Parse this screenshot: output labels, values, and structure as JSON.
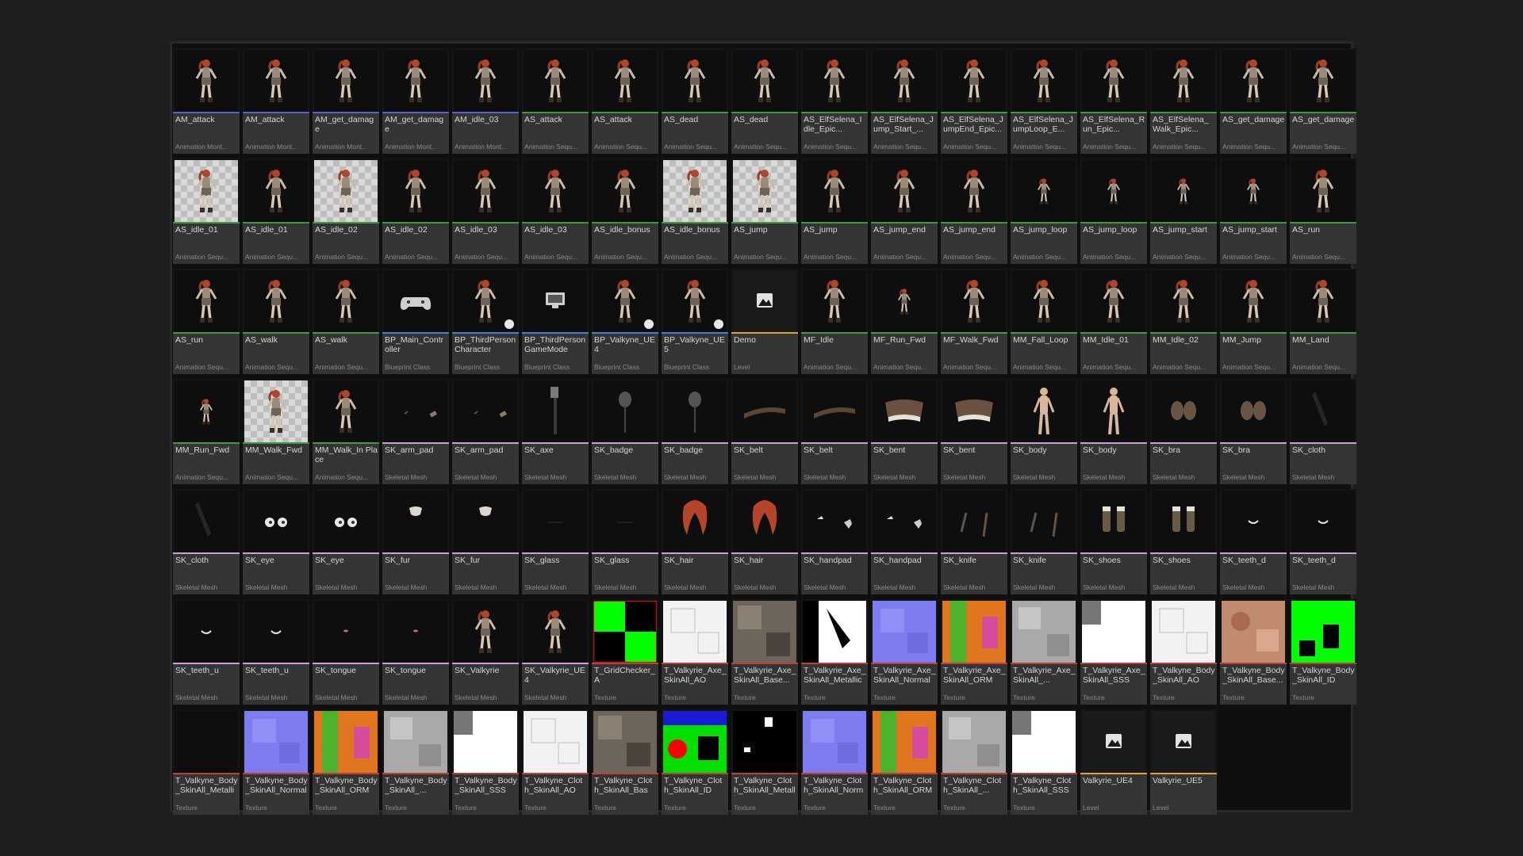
{
  "type_colors": {
    "Animation Montage": "#5b5fd6",
    "Animation Sequence": "#3f9a3f",
    "Blueprint Class": "#3d7fd9",
    "Level": "#e3a13a",
    "Skeletal Mesh": "#c9a0dc",
    "Texture": "#c33b3b"
  },
  "assets": [
    {
      "name": "AM_attack",
      "type": "Animation Mont...",
      "kind": "Animation Montage",
      "thumb": "char"
    },
    {
      "name": "AM_attack",
      "type": "Animation Mont...",
      "kind": "Animation Montage",
      "thumb": "char"
    },
    {
      "name": "AM_get_damage",
      "type": "Animation Mont...",
      "kind": "Animation Montage",
      "thumb": "char"
    },
    {
      "name": "AM_get_damage",
      "type": "Animation Mont...",
      "kind": "Animation Montage",
      "thumb": "char"
    },
    {
      "name": "AM_idle_03",
      "type": "Animation Mont...",
      "kind": "Animation Montage",
      "thumb": "char"
    },
    {
      "name": "AS_attack",
      "type": "Animation Sequ...",
      "kind": "Animation Sequence",
      "thumb": "char"
    },
    {
      "name": "AS_attack",
      "type": "Animation Sequ...",
      "kind": "Animation Sequence",
      "thumb": "char"
    },
    {
      "name": "AS_dead",
      "type": "Animation Sequ...",
      "kind": "Animation Sequence",
      "thumb": "char"
    },
    {
      "name": "AS_dead",
      "type": "Animation Sequ...",
      "kind": "Animation Sequence",
      "thumb": "char"
    },
    {
      "name": "AS_ElfSelena_Idle_Epic...",
      "type": "Animation Sequ...",
      "kind": "Animation Sequence",
      "thumb": "char"
    },
    {
      "name": "AS_ElfSelena_Jump_Start_...",
      "type": "Animation Sequ...",
      "kind": "Animation Sequence",
      "thumb": "char"
    },
    {
      "name": "AS_ElfSelena_JumpEnd_Epic...",
      "type": "Animation Sequ...",
      "kind": "Animation Sequence",
      "thumb": "char"
    },
    {
      "name": "AS_ElfSelena_JumpLoop_E...",
      "type": "Animation Sequ...",
      "kind": "Animation Sequence",
      "thumb": "char"
    },
    {
      "name": "AS_ElfSelena_Run_Epic...",
      "type": "Animation Sequ...",
      "kind": "Animation Sequence",
      "thumb": "char"
    },
    {
      "name": "AS_ElfSelena_Walk_Epic...",
      "type": "Animation Sequ...",
      "kind": "Animation Sequence",
      "thumb": "char"
    },
    {
      "name": "AS_get_damage",
      "type": "Animation Sequ...",
      "kind": "Animation Sequence",
      "thumb": "char"
    },
    {
      "name": "AS_get_damage",
      "type": "Animation Sequ...",
      "kind": "Animation Sequence",
      "thumb": "char"
    },
    {
      "name": "AS_idle_01",
      "type": "Animation Sequ...",
      "kind": "Animation Sequence",
      "thumb": "char-floor"
    },
    {
      "name": "AS_idle_01",
      "type": "Animation Sequ...",
      "kind": "Animation Sequence",
      "thumb": "char"
    },
    {
      "name": "AS_idle_02",
      "type": "Animation Sequ...",
      "kind": "Animation Sequence",
      "thumb": "char-floor"
    },
    {
      "name": "AS_idle_02",
      "type": "Animation Sequ...",
      "kind": "Animation Sequence",
      "thumb": "char"
    },
    {
      "name": "AS_idle_03",
      "type": "Animation Sequ...",
      "kind": "Animation Sequence",
      "thumb": "char"
    },
    {
      "name": "AS_idle_03",
      "type": "Animation Sequ...",
      "kind": "Animation Sequence",
      "thumb": "char"
    },
    {
      "name": "AS_idle_bonus",
      "type": "Animation Sequ...",
      "kind": "Animation Sequence",
      "thumb": "char"
    },
    {
      "name": "AS_idle_bonus",
      "type": "Animation Sequ...",
      "kind": "Animation Sequence",
      "thumb": "char-floor"
    },
    {
      "name": "AS_jump",
      "type": "Animation Sequ...",
      "kind": "Animation Sequence",
      "thumb": "char-floor"
    },
    {
      "name": "AS_jump",
      "type": "Animation Sequ...",
      "kind": "Animation Sequence",
      "thumb": "char"
    },
    {
      "name": "AS_jump_end",
      "type": "Animation Sequ...",
      "kind": "Animation Sequence",
      "thumb": "char"
    },
    {
      "name": "AS_jump_end",
      "type": "Animation Sequ...",
      "kind": "Animation Sequence",
      "thumb": "char"
    },
    {
      "name": "AS_jump_loop",
      "type": "Animation Sequ...",
      "kind": "Animation Sequence",
      "thumb": "char-small"
    },
    {
      "name": "AS_jump_loop",
      "type": "Animation Sequ...",
      "kind": "Animation Sequence",
      "thumb": "char-small"
    },
    {
      "name": "AS_jump_start",
      "type": "Animation Sequ...",
      "kind": "Animation Sequence",
      "thumb": "char-small"
    },
    {
      "name": "AS_jump_start",
      "type": "Animation Sequ...",
      "kind": "Animation Sequence",
      "thumb": "char-small"
    },
    {
      "name": "AS_run",
      "type": "Animation Sequ...",
      "kind": "Animation Sequence",
      "thumb": "char"
    },
    {
      "name": "AS_run",
      "type": "Animation Sequ...",
      "kind": "Animation Sequence",
      "thumb": "char"
    },
    {
      "name": "AS_walk",
      "type": "Animation Sequ...",
      "kind": "Animation Sequence",
      "thumb": "char"
    },
    {
      "name": "AS_walk",
      "type": "Animation Sequ...",
      "kind": "Animation Sequence",
      "thumb": "char"
    },
    {
      "name": "BP_Main_Controller",
      "type": "Blueprint Class",
      "kind": "Blueprint Class",
      "thumb": "gamepad"
    },
    {
      "name": "BP_ThirdPerson Character",
      "type": "Blueprint Class",
      "kind": "Blueprint Class",
      "thumb": "char",
      "badge": true
    },
    {
      "name": "BP_ThirdPerson GameMode",
      "type": "Blueprint Class",
      "kind": "Blueprint Class",
      "thumb": "monitor"
    },
    {
      "name": "BP_Valkyne_UE4",
      "type": "Blueprint Class",
      "kind": "Blueprint Class",
      "thumb": "char",
      "badge": true
    },
    {
      "name": "BP_Valkyne_UE5",
      "type": "Blueprint Class",
      "kind": "Blueprint Class",
      "thumb": "char",
      "badge": true
    },
    {
      "name": "Demo",
      "type": "Level",
      "kind": "Level",
      "thumb": "level"
    },
    {
      "name": "MF_Idle",
      "type": "Animation Sequ...",
      "kind": "Animation Sequence",
      "thumb": "char"
    },
    {
      "name": "MF_Run_Fwd",
      "type": "Animation Sequ...",
      "kind": "Animation Sequence",
      "thumb": "char-small"
    },
    {
      "name": "MF_Walk_Fwd",
      "type": "Animation Sequ...",
      "kind": "Animation Sequence",
      "thumb": "char"
    },
    {
      "name": "MM_Fall_Loop",
      "type": "Animation Sequ...",
      "kind": "Animation Sequence",
      "thumb": "char"
    },
    {
      "name": "MM_Idle_01",
      "type": "Animation Sequ...",
      "kind": "Animation Sequence",
      "thumb": "char"
    },
    {
      "name": "MM_Idle_02",
      "type": "Animation Sequ...",
      "kind": "Animation Sequence",
      "thumb": "char"
    },
    {
      "name": "MM_Jump",
      "type": "Animation Sequ...",
      "kind": "Animation Sequence",
      "thumb": "char"
    },
    {
      "name": "MM_Land",
      "type": "Animation Sequ...",
      "kind": "Animation Sequence",
      "thumb": "char"
    },
    {
      "name": "MM_Run_Fwd",
      "type": "Animation Sequ...",
      "kind": "Animation Sequence",
      "thumb": "char-small"
    },
    {
      "name": "MM_Walk_Fwd",
      "type": "Animation Sequ...",
      "kind": "Animation Sequence",
      "thumb": "char-floor"
    },
    {
      "name": "MM_Walk_In Place",
      "type": "Animation Sequ...",
      "kind": "Animation Sequence",
      "thumb": "char"
    },
    {
      "name": "SK_arm_pad",
      "type": "Skeletal Mesh",
      "kind": "Skeletal Mesh",
      "thumb": "mesh-armpad"
    },
    {
      "name": "SK_arm_pad",
      "type": "Skeletal Mesh",
      "kind": "Skeletal Mesh",
      "thumb": "mesh-armpad"
    },
    {
      "name": "SK_axe",
      "type": "Skeletal Mesh",
      "kind": "Skeletal Mesh",
      "thumb": "mesh-axe"
    },
    {
      "name": "SK_badge",
      "type": "Skeletal Mesh",
      "kind": "Skeletal Mesh",
      "thumb": "mesh-badge"
    },
    {
      "name": "SK_badge",
      "type": "Skeletal Mesh",
      "kind": "Skeletal Mesh",
      "thumb": "mesh-badge"
    },
    {
      "name": "SK_belt",
      "type": "Skeletal Mesh",
      "kind": "Skeletal Mesh",
      "thumb": "mesh-belt"
    },
    {
      "name": "SK_belt",
      "type": "Skeletal Mesh",
      "kind": "Skeletal Mesh",
      "thumb": "mesh-belt"
    },
    {
      "name": "SK_bent",
      "type": "Skeletal Mesh",
      "kind": "Skeletal Mesh",
      "thumb": "mesh-bent"
    },
    {
      "name": "SK_bent",
      "type": "Skeletal Mesh",
      "kind": "Skeletal Mesh",
      "thumb": "mesh-bent"
    },
    {
      "name": "SK_body",
      "type": "Skeletal Mesh",
      "kind": "Skeletal Mesh",
      "thumb": "mesh-body"
    },
    {
      "name": "SK_body",
      "type": "Skeletal Mesh",
      "kind": "Skeletal Mesh",
      "thumb": "mesh-body"
    },
    {
      "name": "SK_bra",
      "type": "Skeletal Mesh",
      "kind": "Skeletal Mesh",
      "thumb": "mesh-bra"
    },
    {
      "name": "SK_bra",
      "type": "Skeletal Mesh",
      "kind": "Skeletal Mesh",
      "thumb": "mesh-bra"
    },
    {
      "name": "SK_cloth",
      "type": "Skeletal Mesh",
      "kind": "Skeletal Mesh",
      "thumb": "mesh-cloth"
    },
    {
      "name": "SK_cloth",
      "type": "Skeletal Mesh",
      "kind": "Skeletal Mesh",
      "thumb": "mesh-cloth"
    },
    {
      "name": "SK_eye",
      "type": "Skeletal Mesh",
      "kind": "Skeletal Mesh",
      "thumb": "mesh-eye"
    },
    {
      "name": "SK_eye",
      "type": "Skeletal Mesh",
      "kind": "Skeletal Mesh",
      "thumb": "mesh-eye"
    },
    {
      "name": "SK_fur",
      "type": "Skeletal Mesh",
      "kind": "Skeletal Mesh",
      "thumb": "mesh-fur"
    },
    {
      "name": "SK_fur",
      "type": "Skeletal Mesh",
      "kind": "Skeletal Mesh",
      "thumb": "mesh-fur"
    },
    {
      "name": "SK_glass",
      "type": "Skeletal Mesh",
      "kind": "Skeletal Mesh",
      "thumb": "mesh-glass"
    },
    {
      "name": "SK_glass",
      "type": "Skeletal Mesh",
      "kind": "Skeletal Mesh",
      "thumb": "mesh-glass"
    },
    {
      "name": "SK_hair",
      "type": "Skeletal Mesh",
      "kind": "Skeletal Mesh",
      "thumb": "mesh-hair"
    },
    {
      "name": "SK_hair",
      "type": "Skeletal Mesh",
      "kind": "Skeletal Mesh",
      "thumb": "mesh-hair"
    },
    {
      "name": "SK_handpad",
      "type": "Skeletal Mesh",
      "kind": "Skeletal Mesh",
      "thumb": "mesh-handpad"
    },
    {
      "name": "SK_handpad",
      "type": "Skeletal Mesh",
      "kind": "Skeletal Mesh",
      "thumb": "mesh-handpad"
    },
    {
      "name": "SK_knife",
      "type": "Skeletal Mesh",
      "kind": "Skeletal Mesh",
      "thumb": "mesh-knife"
    },
    {
      "name": "SK_knife",
      "type": "Skeletal Mesh",
      "kind": "Skeletal Mesh",
      "thumb": "mesh-knife"
    },
    {
      "name": "SK_shoes",
      "type": "Skeletal Mesh",
      "kind": "Skeletal Mesh",
      "thumb": "mesh-shoes"
    },
    {
      "name": "SK_shoes",
      "type": "Skeletal Mesh",
      "kind": "Skeletal Mesh",
      "thumb": "mesh-shoes"
    },
    {
      "name": "SK_teeth_d",
      "type": "Skeletal Mesh",
      "kind": "Skeletal Mesh",
      "thumb": "mesh-teeth"
    },
    {
      "name": "SK_teeth_d",
      "type": "Skeletal Mesh",
      "kind": "Skeletal Mesh",
      "thumb": "mesh-teeth"
    },
    {
      "name": "SK_teeth_u",
      "type": "Skeletal Mesh",
      "kind": "Skeletal Mesh",
      "thumb": "mesh-teeth"
    },
    {
      "name": "SK_teeth_u",
      "type": "Skeletal Mesh",
      "kind": "Skeletal Mesh",
      "thumb": "mesh-teeth"
    },
    {
      "name": "SK_tongue",
      "type": "Skeletal Mesh",
      "kind": "Skeletal Mesh",
      "thumb": "mesh-tongue"
    },
    {
      "name": "SK_tongue",
      "type": "Skeletal Mesh",
      "kind": "Skeletal Mesh",
      "thumb": "mesh-tongue"
    },
    {
      "name": "SK_Valkyrie",
      "type": "Skeletal Mesh",
      "kind": "Skeletal Mesh",
      "thumb": "char"
    },
    {
      "name": "SK_Valkyrie_UE4",
      "type": "Skeletal Mesh",
      "kind": "Skeletal Mesh",
      "thumb": "char"
    },
    {
      "name": "T_GridChecker_A",
      "type": "Texture",
      "kind": "Texture",
      "thumb": "tex-checker"
    },
    {
      "name": "T_Valkyrie_Axe_SkinAll_AO",
      "type": "Texture",
      "kind": "Texture",
      "thumb": "tex-ao"
    },
    {
      "name": "T_Valkyrie_Axe_SkinAll_Base...",
      "type": "Texture",
      "kind": "Texture",
      "thumb": "tex-base"
    },
    {
      "name": "T_Valkyrie_Axe_SkinAll_Metallic",
      "type": "Texture",
      "kind": "Texture",
      "thumb": "tex-metal"
    },
    {
      "name": "T_Valkyrie_Axe_SkinAll_Normal",
      "type": "Texture",
      "kind": "Texture",
      "thumb": "tex-normal"
    },
    {
      "name": "T_Valkyrie_Axe_SkinAll_ORM",
      "type": "Texture",
      "kind": "Texture",
      "thumb": "tex-orm"
    },
    {
      "name": "T_Valkyrie_Axe_SkinAll_...",
      "type": "Texture",
      "kind": "Texture",
      "thumb": "tex-gray"
    },
    {
      "name": "T_Valkyrie_Axe_SkinAll_SSS",
      "type": "Texture",
      "kind": "Texture",
      "thumb": "tex-sss"
    },
    {
      "name": "T_Valkyne_Body_SkinAll_AO",
      "type": "Texture",
      "kind": "Texture",
      "thumb": "tex-ao"
    },
    {
      "name": "T_Valkyne_Body_SkinAll_Base...",
      "type": "Texture",
      "kind": "Texture",
      "thumb": "tex-skin"
    },
    {
      "name": "T_Valkyne_Body_SkinAll_ID",
      "type": "Texture",
      "kind": "Texture",
      "thumb": "tex-id"
    },
    {
      "name": "T_Valkyne_Body_SkinAll_Metallic",
      "type": "Texture",
      "kind": "Texture",
      "thumb": "tex-black"
    },
    {
      "name": "T_Valkyne_Body_SkinAll_Normal",
      "type": "Texture",
      "kind": "Texture",
      "thumb": "tex-normal"
    },
    {
      "name": "T_Valkyne_Body_SkinAll_ORM",
      "type": "Texture",
      "kind": "Texture",
      "thumb": "tex-orm"
    },
    {
      "name": "T_Valkyne_Body_SkinAll_...",
      "type": "Texture",
      "kind": "Texture",
      "thumb": "tex-gray"
    },
    {
      "name": "T_Valkyne_Body_SkinAll_SSS",
      "type": "Texture",
      "kind": "Texture",
      "thumb": "tex-sss"
    },
    {
      "name": "T_Valkyne_Cloth_SkinAll_AO",
      "type": "Texture",
      "kind": "Texture",
      "thumb": "tex-ao"
    },
    {
      "name": "T_Valkyne_Cloth_SkinAll_Base...",
      "type": "Texture",
      "kind": "Texture",
      "thumb": "tex-base"
    },
    {
      "name": "T_Valkyne_Cloth_SkinAll_ID",
      "type": "Texture",
      "kind": "Texture",
      "thumb": "tex-clothid"
    },
    {
      "name": "T_Valkyne_Cloth_SkinAll_Metallic",
      "type": "Texture",
      "kind": "Texture",
      "thumb": "tex-metal-dark"
    },
    {
      "name": "T_Valkyne_Cloth_SkinAll_Normal",
      "type": "Texture",
      "kind": "Texture",
      "thumb": "tex-normal"
    },
    {
      "name": "T_Valkyne_Cloth_SkinAll_ORM",
      "type": "Texture",
      "kind": "Texture",
      "thumb": "tex-orm"
    },
    {
      "name": "T_Valkyne_Cloth_SkinAll_...",
      "type": "Texture",
      "kind": "Texture",
      "thumb": "tex-gray"
    },
    {
      "name": "T_Valkyne_Cloth_SkinAll_SSS",
      "type": "Texture",
      "kind": "Texture",
      "thumb": "tex-sss"
    },
    {
      "name": "Valkyrie_UE4",
      "type": "Level",
      "kind": "Level",
      "thumb": "level"
    },
    {
      "name": "Valkyrie_UE5",
      "type": "Level",
      "kind": "Level",
      "thumb": "level"
    }
  ]
}
